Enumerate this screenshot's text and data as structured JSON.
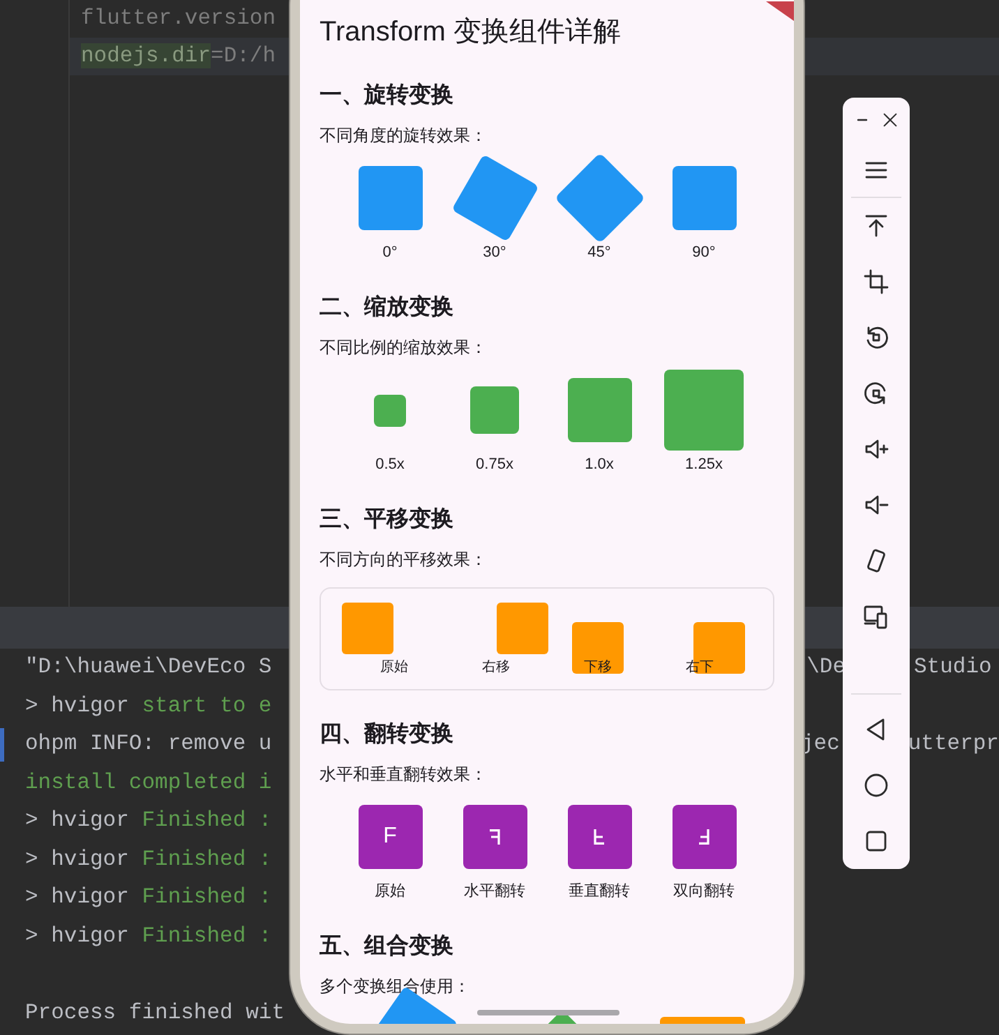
{
  "editor": {
    "lines": [
      {
        "current": false,
        "parts": [
          {
            "text": "flutter.version",
            "kind": "plain"
          }
        ]
      },
      {
        "current": true,
        "parts": [
          {
            "text": "nodejs.dir",
            "kind": "highlight"
          },
          {
            "text": "=D:/h",
            "kind": "plain"
          }
        ]
      }
    ]
  },
  "console": {
    "lines": [
      {
        "parts": [
          {
            "text": "\"D:\\huawei\\DevEco S",
            "kind": "plain"
          }
        ],
        "right_parts": [
          {
            "text": "\\De"
          },
          {
            "text": "Studio"
          }
        ]
      },
      {
        "parts": [
          {
            "text": "> hvigor ",
            "kind": "plain"
          },
          {
            "text": "start to e",
            "kind": "success"
          }
        ]
      },
      {
        "marked": true,
        "parts": [
          {
            "text": "ohpm INFO: remove u",
            "kind": "plain"
          }
        ],
        "right_parts": [
          {
            "text": "jec"
          },
          {
            "text": "utterpr"
          }
        ]
      },
      {
        "parts": [
          {
            "text": "install completed i",
            "kind": "success"
          }
        ]
      },
      {
        "parts": [
          {
            "text": "> hvigor ",
            "kind": "plain"
          },
          {
            "text": "Finished :",
            "kind": "success"
          }
        ]
      },
      {
        "parts": [
          {
            "text": "> hvigor ",
            "kind": "plain"
          },
          {
            "text": "Finished :",
            "kind": "success"
          }
        ]
      },
      {
        "parts": [
          {
            "text": "> hvigor ",
            "kind": "plain"
          },
          {
            "text": "Finished :",
            "kind": "success"
          }
        ]
      },
      {
        "parts": [
          {
            "text": "> hvigor ",
            "kind": "plain"
          },
          {
            "text": "Finished :",
            "kind": "success"
          }
        ]
      },
      {
        "spaced": true,
        "parts": [
          {
            "text": "Process finished wit",
            "kind": "plain"
          }
        ]
      }
    ]
  },
  "phone": {
    "title": "Transform 变换组件详解",
    "sections": [
      {
        "kind": "rotate",
        "heading": "一、旋转变换",
        "description": "不同角度的旋转效果：",
        "items": [
          {
            "kind": "rotate-0",
            "label": "0°"
          },
          {
            "kind": "rotate-30",
            "label": "30°"
          },
          {
            "kind": "rotate-45",
            "label": "45°"
          },
          {
            "kind": "rotate-90",
            "label": "90°"
          }
        ]
      },
      {
        "kind": "scale",
        "heading": "二、缩放变换",
        "description": "不同比例的缩放效果：",
        "items": [
          {
            "kind": "half",
            "label": "0.5x"
          },
          {
            "kind": "three-quarter",
            "label": "0.75x"
          },
          {
            "kind": "full",
            "label": "1.0x"
          },
          {
            "kind": "large",
            "label": "1.25x"
          }
        ]
      },
      {
        "kind": "translate",
        "heading": "三、平移变换",
        "description": "不同方向的平移效果：",
        "items": [
          {
            "kind": "original",
            "label": "原始"
          },
          {
            "kind": "right",
            "label": "右移"
          },
          {
            "kind": "down",
            "label": "下移"
          },
          {
            "kind": "diagonal",
            "label": "右下"
          }
        ]
      },
      {
        "kind": "flip",
        "heading": "四、翻转变换",
        "description": "水平和垂直翻转效果：",
        "items": [
          {
            "kind": "original",
            "glyph": "F",
            "label": "原始"
          },
          {
            "kind": "horizontal",
            "label": "水平翻转"
          },
          {
            "kind": "vertical",
            "label": "垂直翻转"
          },
          {
            "kind": "both",
            "label": "双向翻转"
          }
        ]
      },
      {
        "kind": "combine",
        "heading": "五、组合变换",
        "description": "多个变换组合使用：",
        "items": [
          {
            "kind": "tilted",
            "color": "#2196f3"
          },
          {
            "kind": "diamond",
            "color": "#4caf50"
          },
          {
            "kind": "wide",
            "color": "#ff9800"
          }
        ]
      }
    ]
  }
}
